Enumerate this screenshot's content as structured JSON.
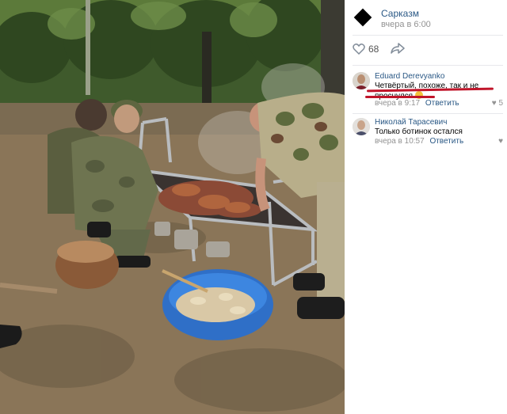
{
  "post": {
    "group_name": "Сарказм",
    "time": "вчера в 6:00",
    "likes": "68"
  },
  "comments": [
    {
      "author": "Eduard Derevyanko",
      "text": "Четвёртый, похоже, так и не проснулся",
      "time": "вчера в 9:17",
      "reply": "Ответить",
      "likes": "5"
    },
    {
      "author": "Николай Тарасевич",
      "text": "Только ботинок остался",
      "time": "вчера в 10:57",
      "reply": "Ответить"
    }
  ],
  "icons": [
    "heart-icon",
    "share-icon",
    "like-icon"
  ],
  "colors": {
    "link": "#2a5885",
    "meta": "#939393",
    "highlight": "#c0152a"
  }
}
